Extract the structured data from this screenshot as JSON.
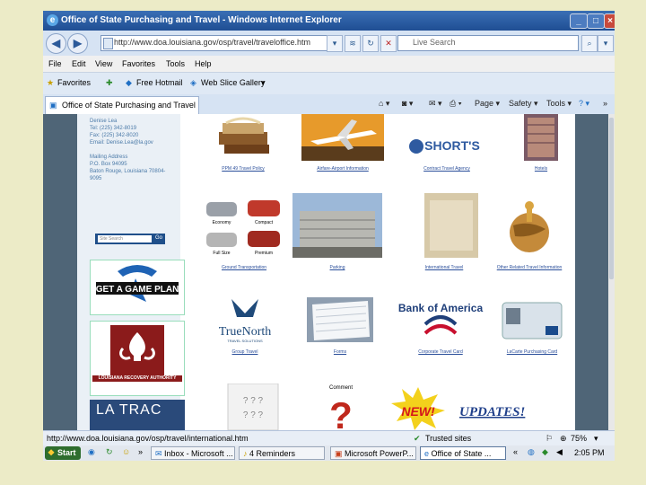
{
  "window": {
    "title": "Office of State Purchasing and Travel - Windows Internet Explorer"
  },
  "address": {
    "url": "http://www.doa.louisiana.gov/osp/travel/traveloffice.htm",
    "search_placeholder": "Live Search"
  },
  "menu": [
    "File",
    "Edit",
    "View",
    "Favorites",
    "Tools",
    "Help"
  ],
  "favorites": {
    "label": "Favorites",
    "items": [
      "Free Hotmail",
      "Web Slice Gallery"
    ]
  },
  "tab": {
    "label": "Office of State Purchasing and Travel"
  },
  "commands": {
    "page": "Page",
    "safety": "Safety",
    "tools": "Tools"
  },
  "sidebar": {
    "contact": "Denise Lea\nTel: (225) 342-8019\nFax: (225) 342-8020\nEmail: Denise.Lea@la.gov\n\nMailing Address\nP.O. Box 94095\nBaton Rouge, Louisiana 70804-\n9095",
    "search_placeholder": "Site Search",
    "go": "Go",
    "banners": [
      "GET A GAME PLAN",
      "LOUISIANA RECOVERY AUTHORITY",
      "LA TRAC"
    ]
  },
  "grid": [
    {
      "caption": "PPM 49 Travel Policy"
    },
    {
      "caption": "Airfare-Airport Information"
    },
    {
      "caption": "Contract Travel Agency",
      "logo": "SHORT'S"
    },
    {
      "caption": "Hotels"
    },
    {
      "caption": "Ground Transportation",
      "cars": [
        "Economy",
        "Compact",
        "Full Size",
        "Premium"
      ]
    },
    {
      "caption": "Parking"
    },
    {
      "caption": "International Travel"
    },
    {
      "caption": "Other Related Travel Information"
    },
    {
      "caption": "Group Travel",
      "logo": "TrueNorth",
      "sub": "TRAVEL SOLUTIONS"
    },
    {
      "caption": "Forms"
    },
    {
      "caption": "Corporate Travel Card",
      "logo": "Bank of America"
    },
    {
      "caption": "LaCarte Purchasing Card"
    },
    {
      "caption": "",
      "label": "Comment"
    },
    {
      "caption": "",
      "label": "NEW!",
      "updates": "UPDATES!"
    }
  ],
  "status": {
    "url": "http://www.doa.louisiana.gov/osp/travel/international.htm",
    "zone": "Trusted sites",
    "zoom": "75%"
  },
  "taskbar": {
    "start": "Start",
    "buttons": [
      "Inbox - Microsoft ...",
      "4 Reminders",
      "Microsoft PowerP...",
      "Office of State ..."
    ],
    "clock": "2:05 PM"
  }
}
